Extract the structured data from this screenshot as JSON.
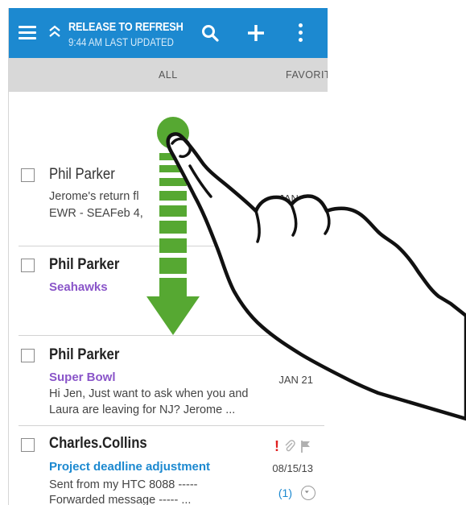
{
  "header": {
    "title": "RELEASE TO REFRESH",
    "subtitle": "9:44 AM LAST UPDATED"
  },
  "tabs": [
    {
      "label": "ALL"
    },
    {
      "label": "FAVORITES"
    }
  ],
  "emails": [
    {
      "sender": "Phil Parker",
      "unread": false,
      "subject": "",
      "preview1": "Jerome's return fl",
      "preview2": "EWR - SEAFeb 4, ",
      "date": "JAN 21"
    },
    {
      "sender": "Phil Parker",
      "unread": true,
      "subject": "Seahawks",
      "subject_color": "#8a55c9",
      "date": ""
    },
    {
      "sender": "Phil Parker",
      "unread": true,
      "subject": "Super Bowl",
      "subject_color": "#8a55c9",
      "preview1": "Hi Jen, Just want to ask when you and",
      "preview2": "Laura are leaving for NJ? Jerome ...",
      "date": "JAN 21"
    },
    {
      "sender": "Charles.Collins",
      "unread": true,
      "subject": "Project deadline adjustment",
      "subject_color": "#1c89d0",
      "preview1": "Sent from my HTC 8088   -----",
      "preview2": "Forwarded message -----  ...",
      "date": "08/15/13",
      "thread_count": "(1)",
      "important_mark": "!"
    }
  ],
  "colors": {
    "actionbar": "#1c89d0",
    "tabbar": "#d8d8d8",
    "arrow": "#56a832"
  },
  "icons": [
    "menu-icon",
    "collapse-chevron-icon",
    "search-icon",
    "add-icon",
    "overflow-menu-icon",
    "attachment-icon",
    "flag-icon",
    "expand-icon",
    "pull-down-arrow",
    "finger-gesture"
  ]
}
